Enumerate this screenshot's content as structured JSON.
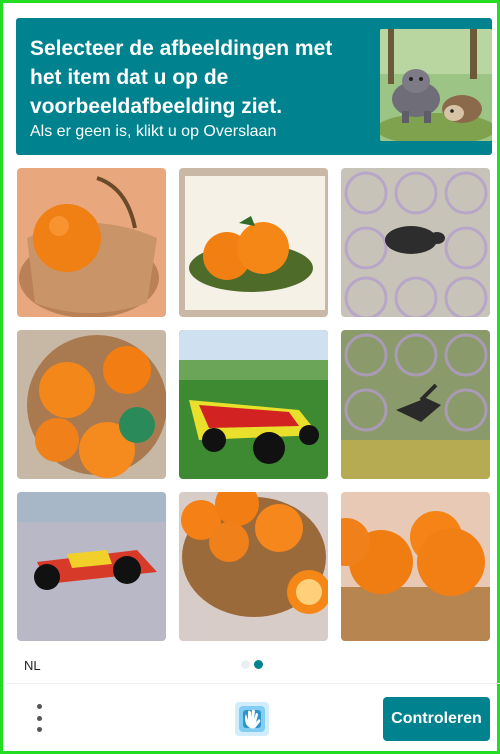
{
  "prompt": {
    "title": "Selecteer de afbeeldingen met het item dat u op de voorbeeldafbeelding ziet.",
    "subtitle": "Als er geen is, klikt u op Overslaan"
  },
  "grid": {
    "tiles": [
      {
        "subject": "orange in basket"
      },
      {
        "subject": "oranges on plate"
      },
      {
        "subject": "noisy animal silhouette"
      },
      {
        "subject": "oranges in bowl"
      },
      {
        "subject": "race car"
      },
      {
        "subject": "noisy flying animal"
      },
      {
        "subject": "race car noisy"
      },
      {
        "subject": "oranges in basket"
      },
      {
        "subject": "oranges in wicker basket"
      }
    ]
  },
  "footer": {
    "language": "NL",
    "pages": [
      {
        "active": false
      },
      {
        "active": true
      }
    ],
    "verify_label": "Controleren",
    "menu_icon": "kebab-menu-icon",
    "logo_icon": "hcaptcha-hand-logo-icon"
  },
  "colors": {
    "accent": "#00838f",
    "frame": "#22dd22"
  }
}
